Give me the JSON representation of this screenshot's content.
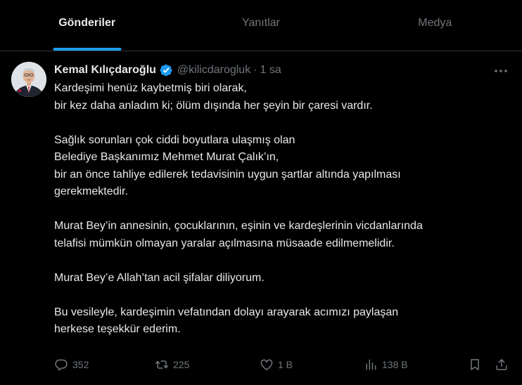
{
  "tabs": [
    {
      "label": "Gönderiler",
      "active": true
    },
    {
      "label": "Yanıtlar",
      "active": false
    },
    {
      "label": "Medya",
      "active": false
    }
  ],
  "tweet": {
    "author_name": "Kemal Kılıçdaroğlu",
    "handle": "@kilicdarogluk",
    "separator": "·",
    "time": "1 sa",
    "paragraphs": [
      [
        "Kardeşimi henüz kaybetmiş biri olarak,",
        "bir kez daha anladım ki; ölüm dışında her şeyin bir çaresi vardır."
      ],
      [
        "Sağlık sorunları çok ciddi boyutlara ulaşmış olan",
        "Belediye Başkanımız Mehmet Murat Çalık’ın,",
        "bir an önce tahliye edilerek tedavisinin uygun şartlar altında yapılması",
        "gerekmektedir."
      ],
      [
        "Murat Bey’in annesinin, çocuklarının, eşinin ve kardeşlerinin vicdanlarında",
        "telafisi mümkün olmayan yaralar açılmasına müsaade edilmemelidir."
      ],
      [
        "Murat Bey’e Allah’tan acil şifalar diliyorum."
      ],
      [
        "Bu vesileyle, kardeşimin vefatından dolayı arayarak acımızı paylaşan",
        "herkese teşekkür ederim."
      ]
    ]
  },
  "actions": {
    "replies": "352",
    "reposts": "225",
    "likes": "1 B",
    "views": "138 B"
  },
  "icons": {
    "verified": "verified-badge-icon",
    "more": "more-dots-icon",
    "reply": "reply-bubble-icon",
    "repost": "repost-arrows-icon",
    "like": "heart-icon",
    "views": "analytics-bars-icon",
    "bookmark": "bookmark-icon",
    "share": "share-upload-icon"
  },
  "colors": {
    "background": "#000000",
    "text": "#e7e9ea",
    "muted": "#71767b",
    "accent": "#1d9bf0",
    "divider": "#2f3336"
  }
}
